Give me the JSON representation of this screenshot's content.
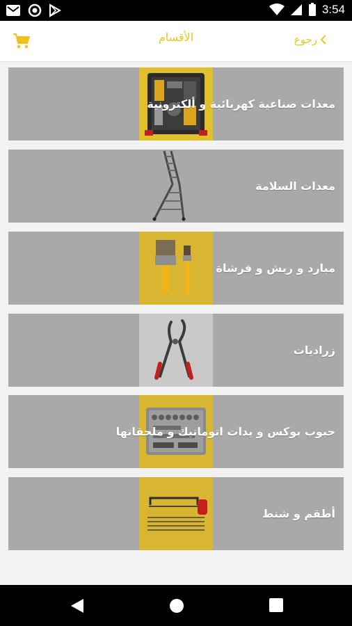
{
  "status": {
    "time": "3:54"
  },
  "header": {
    "title": "الأقسام",
    "back_label": "رجوع",
    "back_icon": "chevron-left-icon",
    "cart_icon": "cart-icon"
  },
  "colors": {
    "accent": "#f2c21b",
    "card_bg": "#a9a9a9",
    "thumb_bg": "#e2bf2c"
  },
  "categories": [
    {
      "label": "معدات صناعية كهربائية و ألكترونية",
      "image": "toolkit-case"
    },
    {
      "label": "معدات السلامة",
      "image": "ladder"
    },
    {
      "label": "مبارد و ريش و فرشاة",
      "image": "paint-brushes"
    },
    {
      "label": "زراديات",
      "image": "pliers"
    },
    {
      "label": "حبوب بوكس و يدات اتوماتيك و ملحقاتها",
      "image": "socket-set"
    },
    {
      "label": "أطقم و شنط",
      "image": "hacksaw"
    }
  ]
}
